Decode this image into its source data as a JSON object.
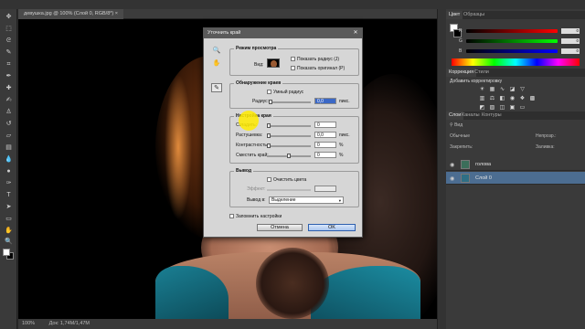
{
  "document": {
    "tab_title": "девушка.jpg @ 100% (Слой 0, RGB/8*) ×"
  },
  "status": {
    "zoom": "100%",
    "doc_size": "Док: 1,74M/1,47M"
  },
  "colors": {
    "accent_selected_layer": "#4c6d91",
    "highlight_field": "#3b68c6",
    "cursor_highlight": "#ffeb00"
  },
  "toolbar": {
    "tools": [
      "move-tool",
      "marquee-tool",
      "lasso-tool",
      "quick-select-tool",
      "crop-tool",
      "eyedropper-tool",
      "healing-tool",
      "brush-tool",
      "clone-stamp-tool",
      "history-brush-tool",
      "eraser-tool",
      "gradient-tool",
      "blur-tool",
      "dodge-tool",
      "pen-tool",
      "type-tool",
      "path-select-tool",
      "shape-tool",
      "hand-tool",
      "zoom-tool"
    ]
  },
  "panels": {
    "color_tabs": [
      "Цвет",
      "Образцы"
    ],
    "color_values": {
      "r": "0",
      "g": "0",
      "b": "0"
    },
    "color_letters": {
      "r": "R",
      "g": "G",
      "b": "B"
    },
    "adjust_tabs": [
      "Коррекция",
      "Стили"
    ],
    "adjust_title": "Добавить корректировку",
    "layers_tabs": [
      "Слои",
      "Каналы",
      "Контуры"
    ],
    "layers_filter": "Вид",
    "blend_mode": "Обычные",
    "opacity_label": "Непрозр.:",
    "lock_label": "Закрепить:",
    "fill_label": "Заливка:",
    "layers": [
      {
        "name": "голова",
        "selected": false
      },
      {
        "name": "Слой 0",
        "selected": true
      }
    ]
  },
  "dialog": {
    "title": "Уточнить край",
    "view_mode": {
      "group_title": "Режим просмотра",
      "view_label": "Вид:",
      "show_radius": "Показать радиус (J)",
      "show_original": "Показать оригинал (P)"
    },
    "edge_detection": {
      "group_title": "Обнаружение краев",
      "smart_radius": "Умный радиус",
      "radius_label": "Радиус:",
      "radius_value": "0,0",
      "radius_unit": "пикс."
    },
    "adjust_edge": {
      "group_title": "Настройка края",
      "rows": [
        {
          "label": "Сгладить:",
          "value": "0",
          "unit": ""
        },
        {
          "label": "Растушевка:",
          "value": "0,0",
          "unit": "пикс."
        },
        {
          "label": "Контрастность:",
          "value": "0",
          "unit": "%"
        },
        {
          "label": "Сместить край:",
          "value": "0",
          "unit": "%"
        }
      ]
    },
    "output": {
      "group_title": "Вывод",
      "decontaminate": "Очистить цвета",
      "amount_label": "Эффект:",
      "output_to_label": "Вывод в:",
      "output_to_value": "Выделение"
    },
    "remember": "Запомнить настройки",
    "cancel": "Отмена",
    "ok": "OK"
  }
}
